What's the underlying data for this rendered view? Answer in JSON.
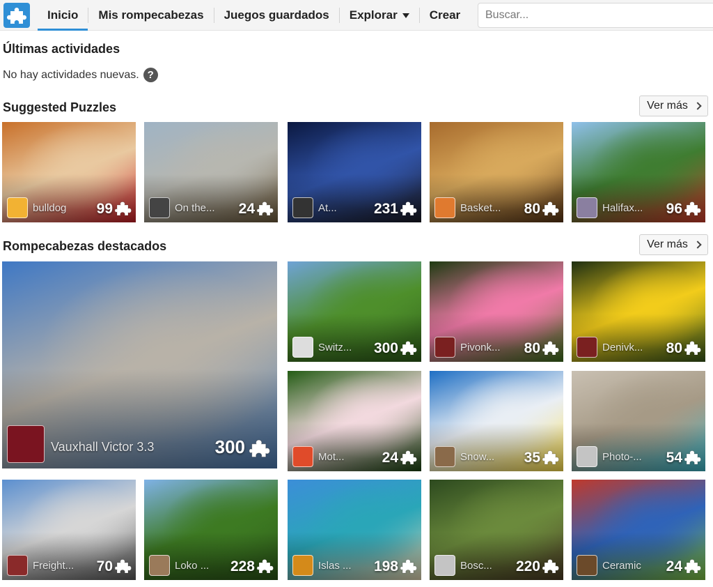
{
  "nav": {
    "items": [
      {
        "label": "Inicio",
        "active": true
      },
      {
        "label": "Mis rompecabezas"
      },
      {
        "label": "Juegos guardados"
      },
      {
        "label": "Explorar",
        "dropdown": true
      },
      {
        "label": "Crear"
      }
    ],
    "search_placeholder": "Buscar..."
  },
  "activity": {
    "title": "Últimas actividades",
    "empty_text": "No hay actividades nuevas.",
    "help_icon": "?"
  },
  "suggested": {
    "title": "Suggested Puzzles",
    "more_label": "Ver más",
    "items": [
      {
        "name": "bulldog",
        "count": "99",
        "colors": [
          "#c8702a",
          "#e9c9a0",
          "#c81d25"
        ],
        "avatar": "#f2b233"
      },
      {
        "name": "On the...",
        "count": "24",
        "colors": [
          "#9fb3c4",
          "#b7b7b0",
          "#6d5a3b"
        ],
        "avatar": "#444444"
      },
      {
        "name": "At...",
        "count": "231",
        "colors": [
          "#0b1840",
          "#3154a8",
          "#1a1a24"
        ],
        "avatar": "#333333"
      },
      {
        "name": "Basket...",
        "count": "80",
        "colors": [
          "#a76b2d",
          "#d8a95c",
          "#5a3515"
        ],
        "avatar": "#e07a2f"
      },
      {
        "name": "Halifax...",
        "count": "96",
        "colors": [
          "#8fc0ea",
          "#3f7d31",
          "#cf3c2c"
        ],
        "avatar": "#8a7fa0"
      }
    ]
  },
  "featured": {
    "title": "Rompecabezas destacados",
    "more_label": "Ver más",
    "big": {
      "name": "Vauxhall Victor 3.3",
      "count": "300",
      "colors": [
        "#3f78c4",
        "#b8b2a8",
        "#4c7cb5"
      ],
      "avatar": "#7a1420"
    },
    "items": [
      {
        "name": "Switz...",
        "count": "300",
        "colors": [
          "#6fa3d6",
          "#4e8f2b",
          "#2e5e19"
        ],
        "avatar": "#dddddd"
      },
      {
        "name": "Pivonk...",
        "count": "80",
        "colors": [
          "#1f3b12",
          "#f07aa8",
          "#3e6f1c"
        ],
        "avatar": "#7a2020"
      },
      {
        "name": "Denivk...",
        "count": "80",
        "colors": [
          "#1e2f12",
          "#f2cc1b",
          "#38591a"
        ],
        "avatar": "#7a2020"
      },
      {
        "name": "Mot...",
        "count": "24",
        "colors": [
          "#245c15",
          "#f2d9de",
          "#1b4410"
        ],
        "avatar": "#e04b2a"
      },
      {
        "name": "Snow...",
        "count": "35",
        "colors": [
          "#1f6fc4",
          "#e9eef4",
          "#ffe14a"
        ],
        "avatar": "#8a6a4a"
      },
      {
        "name": "Photo-...",
        "count": "54",
        "colors": [
          "#c9c0b2",
          "#a69a86",
          "#3db7c9"
        ],
        "avatar": "#c4c4c4"
      },
      {
        "name": "Freight...",
        "count": "70",
        "colors": [
          "#5b8fcf",
          "#d6d6d6",
          "#5a5a5a"
        ],
        "avatar": "#8a2a2a"
      },
      {
        "name": "Loko ...",
        "count": "228",
        "colors": [
          "#7fb2e6",
          "#3d7a22",
          "#2c5718"
        ],
        "avatar": "#9a7a5a"
      },
      {
        "name": "Islas ...",
        "count": "198",
        "colors": [
          "#3c8ed8",
          "#2aa6b8",
          "#e7d9b4"
        ],
        "avatar": "#d48a1a"
      },
      {
        "name": "Bosc...",
        "count": "220",
        "colors": [
          "#2d4a1f",
          "#6b8a3c",
          "#4c3a24"
        ],
        "avatar": "#c4c4c4"
      },
      {
        "name": "Ceramic",
        "count": "24",
        "colors": [
          "#c0392b",
          "#2f63b8",
          "#7fc241"
        ],
        "avatar": "#6b4a2a"
      }
    ]
  }
}
